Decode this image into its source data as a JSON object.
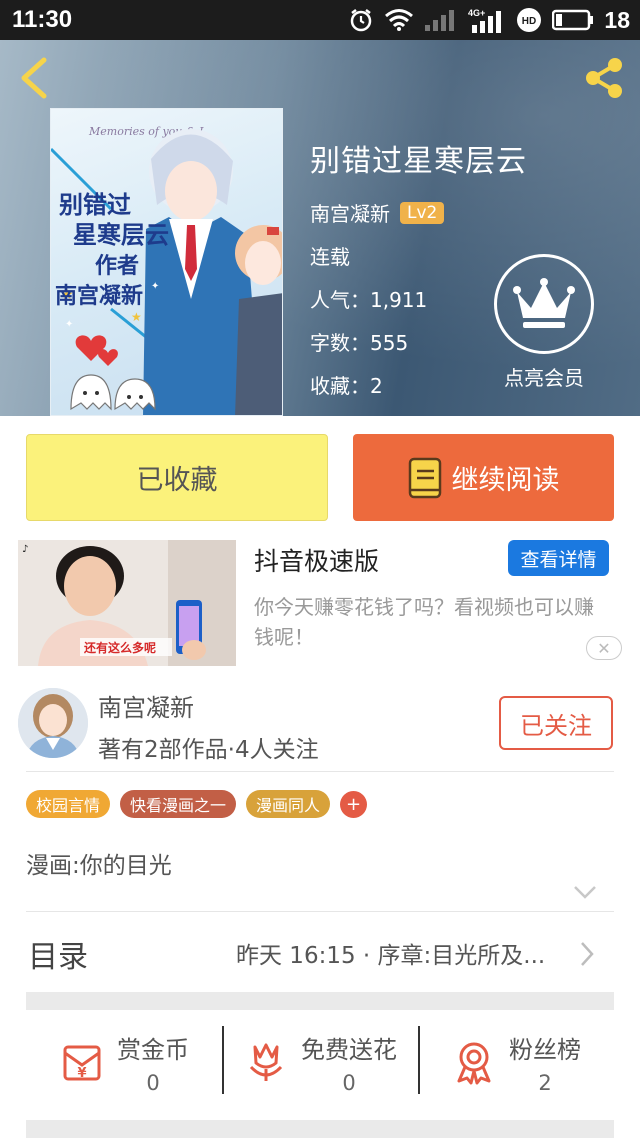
{
  "status_bar": {
    "time": "11:30",
    "network": "4G+",
    "hd": "HD",
    "battery": "18"
  },
  "cover": {
    "caption_en": "Memories of you & I",
    "lines": [
      "别错过",
      "星寒层云",
      "作者",
      "南宫凝新"
    ]
  },
  "book": {
    "title": "别错过星寒层云",
    "author": "南宫凝新",
    "level": "Lv2",
    "status": "连载",
    "popularity": "人气：1,911",
    "word_count": "字数：555",
    "favorites": "收藏：2"
  },
  "vip": {
    "label": "点亮会员"
  },
  "actions": {
    "collected_label": "已收藏",
    "continue_label": "继续阅读"
  },
  "ad": {
    "title": "抖音极速版",
    "detail_label": "查看详情",
    "desc": "你今天赚零花钱了吗？看视频也可以赚钱呢！",
    "thumb_caption": "还有这么多呢",
    "close": "✕"
  },
  "author": {
    "name": "南宫凝新",
    "stats": "著有2部作品·4人关注",
    "follow_label": "已关注"
  },
  "tags": [
    {
      "label": "校园言情",
      "color": "#f0a834"
    },
    {
      "label": "快看漫画之一",
      "color": "#c25f46"
    },
    {
      "label": "漫画同人",
      "color": "#d8a23a"
    }
  ],
  "tag_add": "+",
  "description": "漫画:你的目光",
  "toc": {
    "label": "目录",
    "latest": "昨天 16:15 · 序章:目光所及..."
  },
  "stats": [
    {
      "label": "赏金币",
      "count": "0",
      "icon": "red-envelope-icon"
    },
    {
      "label": "免费送花",
      "count": "0",
      "icon": "flower-icon"
    },
    {
      "label": "粉丝榜",
      "count": "2",
      "icon": "medal-icon"
    }
  ],
  "colors": {
    "accent_orange": "#ed6a3d",
    "collect_yellow": "#fbf27b",
    "follow_red": "#e45b45",
    "ad_blue": "#1b79e0",
    "vip_gold": "#f0b24a"
  }
}
